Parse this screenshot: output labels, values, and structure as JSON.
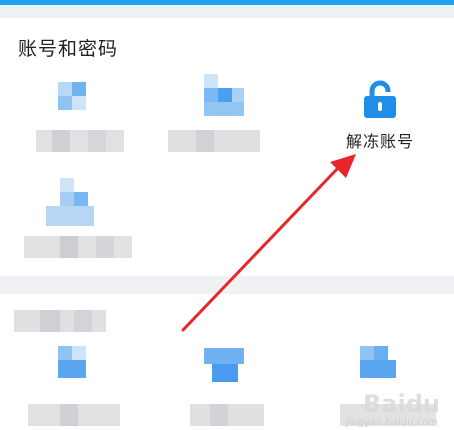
{
  "section": {
    "title": "账号和密码"
  },
  "unlock": {
    "label": "解冻账号",
    "icon": "lock-open-icon",
    "color": "#1f8ee8"
  },
  "accent": {
    "arrow": "#e8262a",
    "top_strip": "#1da1f2"
  },
  "watermark": {
    "text": "Baiåº¦ ",
    "sub": "jingyan.baidu.com"
  }
}
